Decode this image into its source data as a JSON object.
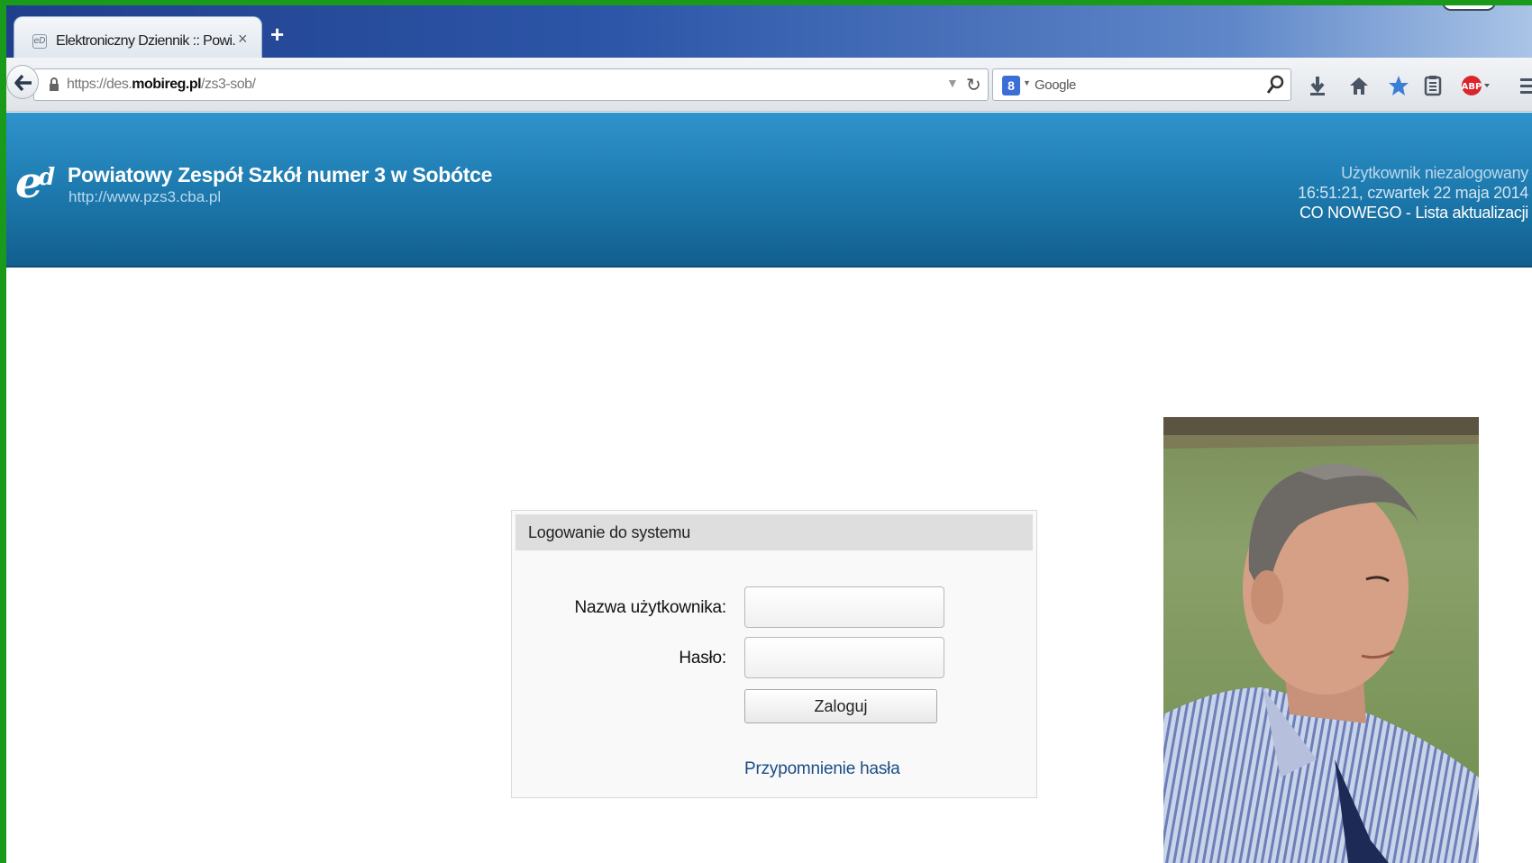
{
  "browser": {
    "tab": {
      "title": "Elektroniczny Dziennik :: Powi...",
      "close_glyph": "×"
    },
    "new_tab_glyph": "+",
    "address": {
      "scheme_prefix": "https://des.",
      "host": "mobireg.pl",
      "path": "/zs3-sob/"
    },
    "search": {
      "engine_letter": "8",
      "placeholder": "Google"
    },
    "toolbar_icons": [
      "download-icon",
      "home-icon",
      "bookmark-star-icon",
      "reading-list-icon",
      "adblock-icon",
      "menu-icon"
    ]
  },
  "site": {
    "school_name": "Powiatowy Zespół Szkół numer 3 w Sobótce",
    "school_url": "http://www.pzs3.cba.pl",
    "user_status": "Użytkownik niezalogowany",
    "datetime": "16:51:21, czwartek 22 maja 2014",
    "whats_new": "CO NOWEGO - Lista aktualizacji"
  },
  "login": {
    "title": "Logowanie do systemu",
    "username_label": "Nazwa użytkownika:",
    "password_label": "Hasło:",
    "submit_label": "Zaloguj",
    "remind_link": "Przypomnienie hasła"
  },
  "colors": {
    "frame_green": "#1a9a1a",
    "header_blue": "#1f7db2",
    "link_blue": "#1a4c86"
  }
}
